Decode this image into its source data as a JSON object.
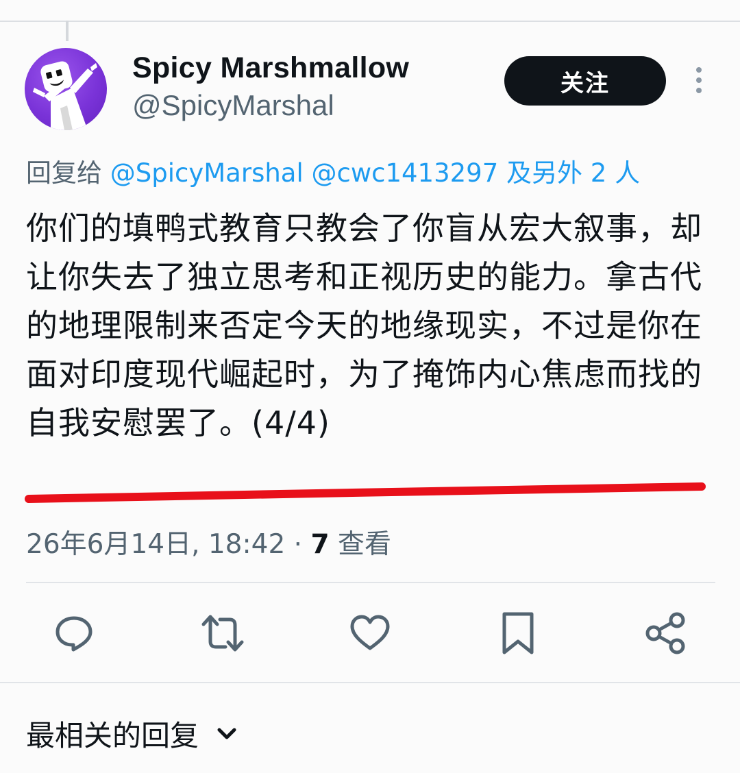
{
  "author": {
    "display_name": "Spicy Marshmallow",
    "handle": "@SpicyMarshal"
  },
  "follow_button": {
    "label": "关注"
  },
  "reply_context": {
    "prefix": "回复给",
    "mentions": [
      "@SpicyMarshal",
      "@cwc1413297"
    ],
    "suffix": "及另外 2 人"
  },
  "tweet": {
    "text": "你们的填鸭式教育只教会了你盲从宏大叙事，却让你失去了独立思考和正视历史的能力。拿古代的地理限制来否定今天的地缘现实，不过是你在面对印度现代崛起时，为了掩饰内心焦虑而找的自我安慰罢了。(4/4)",
    "timestamp": "26年6月14日, 18:42 ·",
    "views_count": "7",
    "views_label": "查看"
  },
  "actions": [
    {
      "name": "reply",
      "icon": "reply-icon"
    },
    {
      "name": "retweet",
      "icon": "retweet-icon"
    },
    {
      "name": "like",
      "icon": "heart-icon"
    },
    {
      "name": "bookmark",
      "icon": "bookmark-icon"
    },
    {
      "name": "share",
      "icon": "share-icon"
    }
  ],
  "replies_sort": {
    "label": "最相关的回复"
  },
  "colors": {
    "text_primary": "#0f1419",
    "text_secondary": "#536471",
    "accent": "#1d9bf0",
    "annotation_red": "#e8101a",
    "avatar_purple": "#7a33d8"
  }
}
